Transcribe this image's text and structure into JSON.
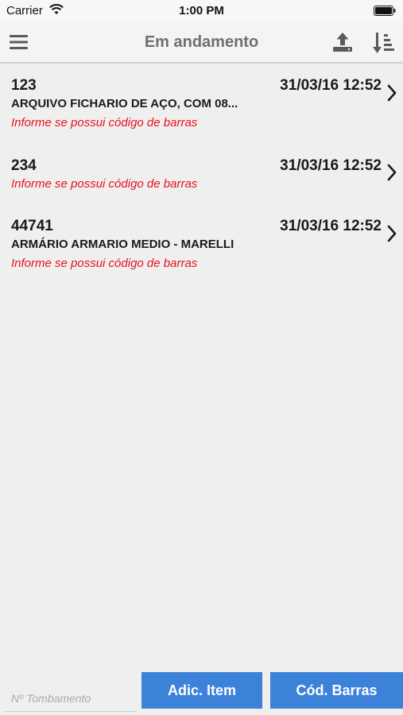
{
  "status_bar": {
    "carrier": "Carrier",
    "time": "1:00 PM"
  },
  "nav": {
    "title": "Em andamento",
    "left_icon": "menu-icon",
    "right_icons": [
      "upload-icon",
      "sort-icon"
    ]
  },
  "items": [
    {
      "code": "123",
      "date": "31/03/16 12:52",
      "description": "ARQUIVO FICHARIO DE AÇO, COM 08...",
      "hint": "Informe se possui código de barras"
    },
    {
      "code": "234",
      "date": "31/03/16 12:52",
      "description": "",
      "hint": "Informe se possui código de barras"
    },
    {
      "code": "44741",
      "date": "31/03/16 12:52",
      "description": "ARMÁRIO ARMARIO MEDIO - MARELLI",
      "hint": "Informe se possui código de barras"
    }
  ],
  "bottom": {
    "tombamento_placeholder": "Nº Tombamento",
    "tombamento_value": "",
    "add_item_label": "Adic. Item",
    "barcode_label": "Cód. Barras"
  },
  "colors": {
    "accent": "#3d82d9",
    "hint": "#e8121c",
    "title": "#6f6f6f",
    "background": "#efefef"
  }
}
